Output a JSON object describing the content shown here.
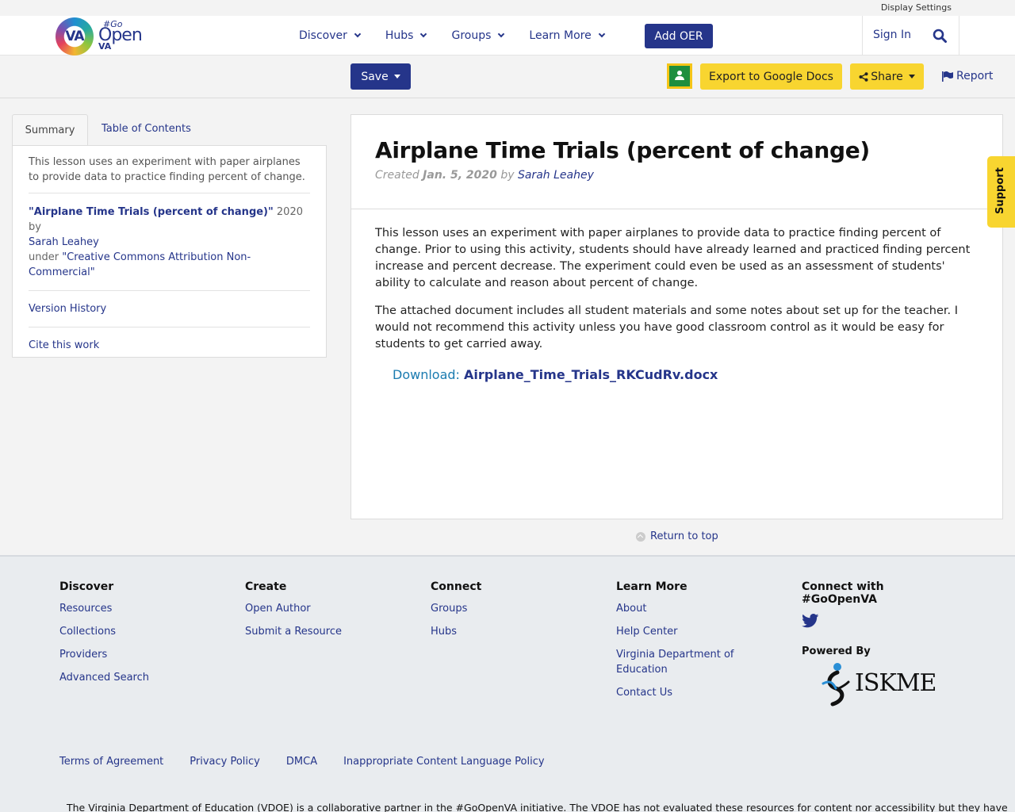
{
  "topbar": {
    "display_settings": "Display Settings"
  },
  "header": {
    "logo": {
      "va": "VA",
      "go": "#Go",
      "open": "Open",
      "va_small": "VA"
    },
    "nav": [
      {
        "label": "Discover"
      },
      {
        "label": "Hubs"
      },
      {
        "label": "Groups"
      },
      {
        "label": "Learn More"
      }
    ],
    "add_oer": "Add OER",
    "sign_in": "Sign In"
  },
  "toolbar": {
    "save": "Save",
    "export": "Export to Google Docs",
    "share": "Share",
    "report": "Report"
  },
  "tabs": {
    "summary": "Summary",
    "toc": "Table of Contents"
  },
  "sidebar": {
    "summary": "This lesson uses an experiment with paper airplanes to provide data to practice finding percent of change.",
    "credit": {
      "title": "\"Airplane Time Trials (percent of change)\"",
      "year_by": " 2020 by ",
      "author": "Sarah Leahey",
      "under": "under ",
      "license": "\"Creative Commons Attribution Non-Commercial\""
    },
    "version_history": "Version History",
    "cite": "Cite this work"
  },
  "resource": {
    "title": "Airplane Time Trials (percent of change)",
    "created_label": "Created ",
    "created_date": "Jan. 5, 2020",
    "by": " by ",
    "author": "Sarah Leahey",
    "paragraphs": [
      "This lesson uses an experiment with paper airplanes to provide data to practice finding percent of change.  Prior to using this activity, students should have already learned and practiced finding percent increase and percent decrease. The experiment could even be used as an assessment of students' ability to calculate and reason about percent of change.",
      "The attached document includes all student materials and some notes about set up for the teacher. I would not recommend this activity unless you have good classroom control as it would be easy for students to get carried away."
    ],
    "download_label": "Download: ",
    "download_file": "Airplane_Time_Trials_RKCudRv.docx"
  },
  "support": "Support",
  "return_to_top": "Return to top",
  "footer": {
    "columns": [
      {
        "heading": "Discover",
        "links": [
          "Resources",
          "Collections",
          "Providers",
          "Advanced Search"
        ]
      },
      {
        "heading": "Create",
        "links": [
          "Open Author",
          "Submit a Resource"
        ]
      },
      {
        "heading": "Connect",
        "links": [
          "Groups",
          "Hubs"
        ]
      },
      {
        "heading": "Learn More",
        "links": [
          "About",
          "Help Center",
          "Virginia Department of Education",
          "Contact Us"
        ]
      }
    ],
    "connect_heading": "Connect with #GoOpenVA",
    "powered_by": "Powered By",
    "iskme": "ISKME",
    "legal": [
      "Terms of Agreement",
      "Privacy Policy",
      "DMCA",
      "Inappropriate Content Language Policy"
    ],
    "disclaimer": "The Virginia Department of Education (VDOE) is a collaborative partner in the #GoOpenVA initiative. The VDOE has not evaluated these resources for content nor accessibility but they have"
  },
  "colors": {
    "brand": "#25358a",
    "accent_yellow": "#f8d530",
    "classroom_green": "#1e8e3e"
  }
}
